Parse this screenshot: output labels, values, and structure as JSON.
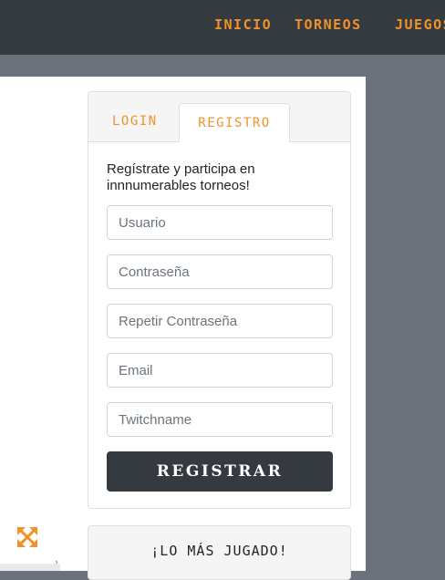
{
  "nav": {
    "items": [
      {
        "label": "INICIO"
      },
      {
        "label": "TORNEOS"
      },
      {
        "label": "JUEGOS"
      }
    ]
  },
  "auth": {
    "tabs": {
      "login": "LOGIN",
      "registro": "REGISTRO"
    },
    "active_tab": "registro",
    "intro": "Regístrate y participa en innnumerables torneos!",
    "fields": {
      "usuario": {
        "placeholder": "Usuario",
        "value": ""
      },
      "password": {
        "placeholder": "Contraseña",
        "value": ""
      },
      "repeat_password": {
        "placeholder": "Repetir Contraseña",
        "value": ""
      },
      "email": {
        "placeholder": "Email",
        "value": ""
      },
      "twitchname": {
        "placeholder": "Twitchname",
        "value": ""
      }
    },
    "submit_label": "REGISTRAR"
  },
  "most_played": {
    "title": "¡LO MÁS JUGADO!"
  },
  "icons": {
    "expand": "expand-icon"
  },
  "colors": {
    "accent": "#f0922a",
    "dark": "#353a40",
    "page_bg": "#6c727c"
  }
}
